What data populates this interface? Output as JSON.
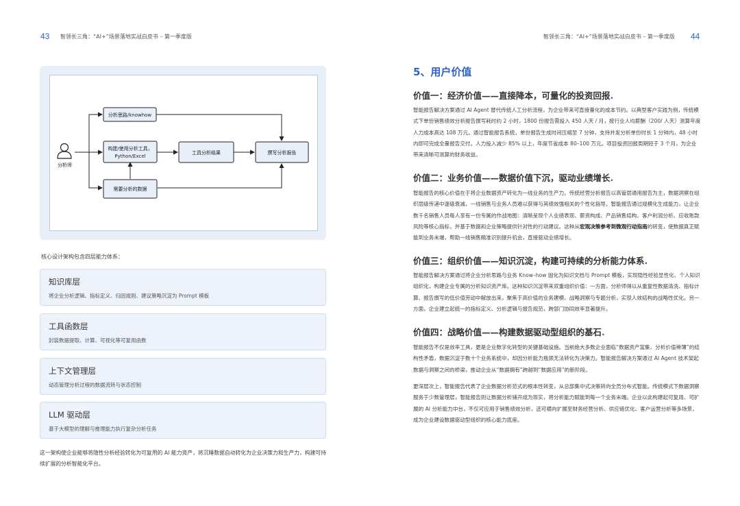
{
  "header": {
    "left_page_number": "43",
    "left_title": "智领长三角：“AI+”场景落地实战白皮书 – 第一季度版",
    "right_title": "智领长三角：“AI+”场景落地实战白皮书 – 第一季度版",
    "right_page_number": "44"
  },
  "diagram": {
    "actor": "分析师",
    "node_methods": "分析思路/knowhow",
    "node_tools_line1": "构建/使用分析工具，",
    "node_tools_line2": "Python/Excel",
    "node_data": "需要分析的数据",
    "node_result": "工具分析结果",
    "node_report": "撰写分析报告"
  },
  "left": {
    "caption": "核心设计架构包含四层能力体系：",
    "layers": [
      {
        "title": "知识库层",
        "desc": "将企业分析逻辑、指标定义、归因规则、建议策略沉淀为 Prompt 模板"
      },
      {
        "title": "工具函数层",
        "desc": "封装数据提取、计算、可视化等可复用函数"
      },
      {
        "title": "上下文管理层",
        "desc": "动态管理分析过程的数据流转与状态控制"
      },
      {
        "title": "LLM 驱动层",
        "desc": "基于大模型的理解与推理能力执行复杂分析任务"
      }
    ],
    "summary": "这一架构使企业能够将隐性分析经验转化为可复用的 AI 能力资产，将沉睡数据自动转化为企业决策力和生产力，构建可持续扩展的分析智能化平台。"
  },
  "right": {
    "section_title": "5、用户价值",
    "v1": {
      "title": "价值一：经济价值——直接降本，可量化的投资回报",
      "para": "智能报告解决方案通过 AI Agent 替代传统人工分析流程，为企业带来可直接量化的成本节约。以典型客户实践为例，传统模式下单份销售绩效分析报告撰写耗时约 2 小时，1800 份报告需投入 450 人天 / 月，按行业人均薪酬（200/ 人天）测算年度人力成本高达 108 万元。通过智能报告系统，单份报告生成时间压缩至 7 分钟，支持并发分析单份时长 1 分钟内，48 小时内即可完成全量报告交付。人力投入减少 85% 以上，年度节省成本 80–100 万元。项目投资回报周期短于 3 个月，为企业带来清晰可测算的财务收益。"
    },
    "v2": {
      "title": "价值二：业务价值——数据价值下沉，驱动业绩增长",
      "para_a": "智能报告的核心价值在于将企业数据资产转化为一线业务的生产力。传统经营分析报告以高管层通用报告为主，数据洞察在组织层级传递中逐级衰减，一线销售与业务人员难以获得与其绩效强相关的个性化指导。智能报告通过规模化生成能力，让企业数千名销售人员每人享有一份专属的作战地图：清晰呈现个人业绩表现、薪资构成、产品销售结构、客户利润分析、应收账款风险等核心指标，并基于数据和企业策略提供针对性的行动建议。这种从",
      "para_bold": "宏观决策参考到微观行动指南",
      "para_b": "的转变，使数据真正赋能到业务末端，帮助一线销售精准识别提升机会，直接驱动业绩增长。"
    },
    "v3": {
      "title": "价值三：组织价值——知识沉淀，构建可持续的分析能力体系",
      "para": "智能报告解决方案通过将企业分析思路与业务 Know–how 固化为知识文档与 Prompt 模板，实现隐性经验显性化、个人知识组织化，构建企业专属的分析知识资产库。这种知识沉淀带来双重组织价值：一方面，分析师得以从重复性数据清洗、指标计算、报告撰写的低价值劳动中解放出来，聚焦于高价值的业务建模、战略洞察与专题分析，实现人效结构的战略性优化。另一方面，企业建立起统一的指标定义、分析逻辑与报告规范，跨部门协同效率显著提升。"
    },
    "v4": {
      "title": "价值四：战略价值——构建数据驱动型组织的基石",
      "para1": "智能报告不仅是效率工具，更是企业数字化转型的关键基础设施。当前绝大多数企业面临“数据资产富集、分析价值稀薄”的结构性矛盾，数据沉淀于数十个业务系统中，却因分析能力瓶颈无法转化为决策力。智能报告解决方案通过 AI Agent 技术架起数据与洞察之间的桥梁，推动企业从“数据拥有”跨越到“数据应用”的新阶段。",
      "para2": "更深层次上，智能报告代表了企业数据分析范式的根本性转变，从总部集中式决策转向全员分布式智能。传统模式下数据洞察服务于少数管理层，智能报告则让数据分析铺开成为现实，将分析能力赋能到每一个业务末端。企业以此构建起可复用、可扩展的 AI 分析能力中台，不仅可应用于销售绩效分析，还可横向扩展至财务经营分析、供应链优化、客户运营分析等多场景，成为企业建设数据驱动型组织的核心能力底座。"
    }
  }
}
